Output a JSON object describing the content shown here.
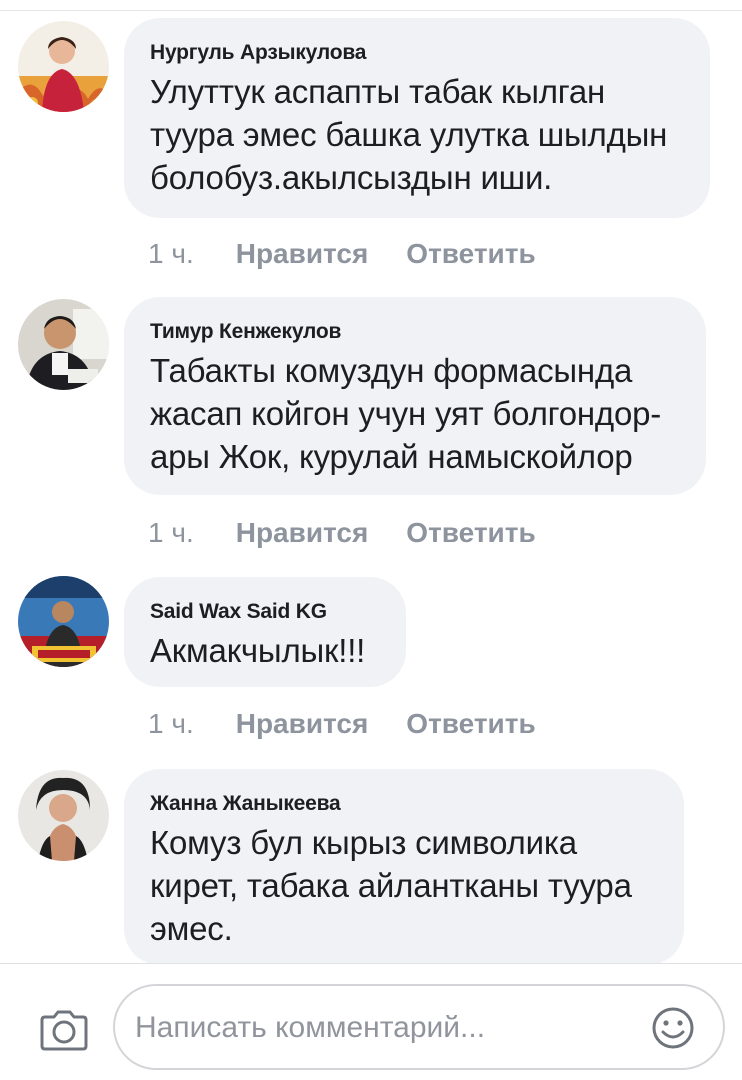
{
  "comments": [
    {
      "author": "Нургуль Арзыкулова",
      "text": "Улуттук аспапты табак кылган\nтуура эмес башка улутка шылдын\nболобуз.акылсыздын иши.",
      "time": "1 ч.",
      "like_label": "Нравится",
      "reply_label": "Ответить"
    },
    {
      "author": "Тимур Кенжекулов",
      "text": "Табакты комуздун формасында\nжасап койгон учун уят болгондор-\nары Жок, курулай намыскойлор",
      "time": "1 ч.",
      "like_label": "Нравится",
      "reply_label": "Ответить"
    },
    {
      "author": "Said Wax Said KG",
      "text": "Акмакчылык!!!",
      "time": "1 ч.",
      "like_label": "Нравится",
      "reply_label": "Ответить"
    },
    {
      "author": "Жанна Жаныкеева",
      "text": "Комуз бул кырыз символика\nкирет,  табака айлантканы туура\nэмес.",
      "time": "",
      "like_label": "",
      "reply_label": ""
    }
  ],
  "composer": {
    "placeholder": "Написать комментарий...",
    "camera_icon": "camera-icon",
    "emoji_icon": "smiley-icon"
  },
  "colors": {
    "bubble": "#f1f2f5",
    "meta_text": "#8d949e",
    "text": "#1c1e21"
  }
}
